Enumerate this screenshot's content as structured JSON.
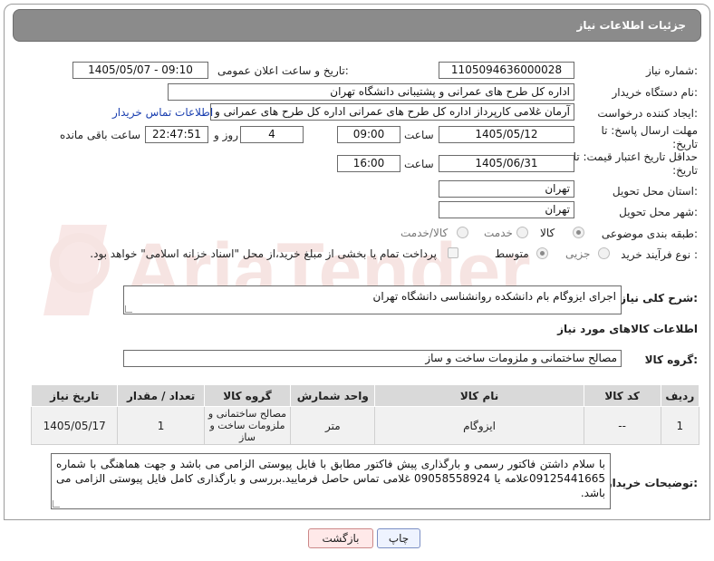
{
  "header": {
    "title": "جزئیات اطلاعات نیاز"
  },
  "fields": {
    "need_number_label": "شماره نیاز:",
    "need_number": "1105094636000028",
    "announce_label": "تاریخ و ساعت اعلان عمومی:",
    "announce_value": "1405/05/07 - 09:10",
    "buyer_org_label": "نام دستگاه خریدار:",
    "buyer_org": "اداره کل طرح های عمرانی و پشتیبانی دانشگاه تهران",
    "creator_label": "ایجاد کننده درخواست:",
    "creator": "آرمان غلامی کارپرداز اداره کل طرح های عمرانی اداره کل طرح های عمرانی و پشتیبانی",
    "contact_link": "اطلاعات تماس خریدار",
    "deadline_label": "مهلت ارسال پاسخ: تا تاریخ:",
    "deadline_date": "1405/05/12",
    "deadline_time_label": "ساعت",
    "deadline_time": "09:00",
    "days_value": "4",
    "days_label": "روز و",
    "remaining_time": "22:47:51",
    "remaining_label": "ساعت باقی مانده",
    "validity_label": "حداقل تاریخ اعتبار قیمت: تا تاریخ:",
    "validity_date": "1405/06/31",
    "validity_time_label": "ساعت",
    "validity_time": "16:00",
    "province_label": "استان محل تحویل:",
    "province": "تهران",
    "city_label": "شهر محل تحویل:",
    "city": "تهران",
    "category_label": "طبقه بندی موضوعی:",
    "category_options": [
      "کالا",
      "خدمت",
      "کالا/خدمت"
    ],
    "process_label": "نوع فرآیند خرید :",
    "process_options": [
      "جزیی",
      "متوسط"
    ],
    "payment_note": "پرداخت تمام یا بخشی از مبلغ خرید،از محل \"اسناد خزانه اسلامی\" خواهد بود."
  },
  "description": {
    "label": "شرح کلی نیاز:",
    "value": "اجرای ایزوگام بام دانشکده روانشناسی دانشگاه تهران"
  },
  "goods": {
    "section_title": "اطلاعات کالاهای مورد نیاز",
    "group_label": "گروه کالا:",
    "group_value": "مصالح ساختمانی و ملزومات ساخت و ساز",
    "columns": [
      "ردیف",
      "کد کالا",
      "نام کالا",
      "واحد شمارش",
      "گروه کالا",
      "تعداد / مقدار",
      "تاریخ نیاز"
    ],
    "rows": [
      [
        "1",
        "--",
        "ایزوگام",
        "متر",
        "مصالح ساختمانی و ملزومات ساخت و ساز",
        "1",
        "1405/05/17"
      ]
    ]
  },
  "buyer_notes": {
    "label": "توضیحات خریدار:",
    "value": "با سلام داشتن فاکتور رسمی و بارگذاری پیش فاکتور مطابق با فایل پیوستی الزامی می باشد و جهت هماهنگی با شماره 09125441665علامه یا 09058558924 غلامی تماس حاصل فرمایید.بررسی و بارگذاری کامل فایل پیوستی الزامی می باشد."
  },
  "buttons": {
    "print": "چاپ",
    "back": "بازگشت"
  },
  "watermark": {
    "text": "AriaTender.neT"
  },
  "colors": {
    "header": "#8b8b8b",
    "watermark": "#c0392b",
    "link": "#1a3fb0"
  }
}
